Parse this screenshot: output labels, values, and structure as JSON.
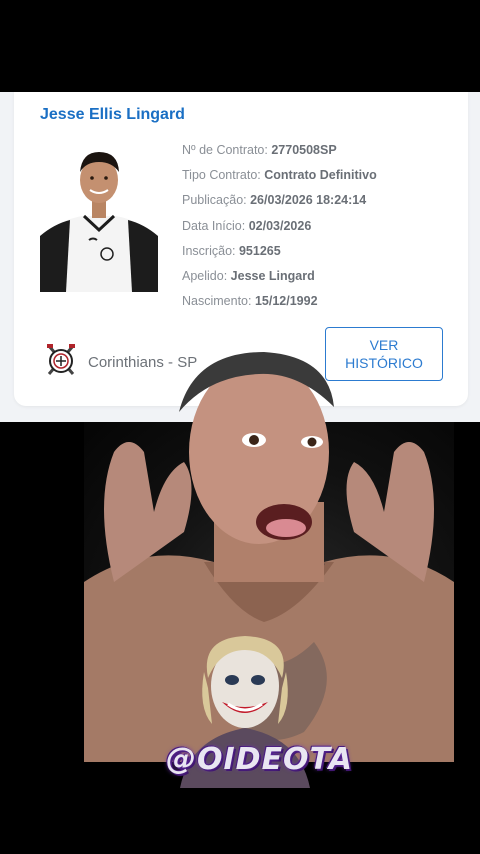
{
  "profile": {
    "name": "Jesse Ellis Lingard",
    "fields": [
      {
        "label": "Nº de Contrato:",
        "value": "2770508SP"
      },
      {
        "label": "Tipo Contrato:",
        "value": "Contrato Definitivo"
      },
      {
        "label": "Publicação:",
        "value": "26/03/2026 18:24:14"
      },
      {
        "label": "Data Início:",
        "value": "02/03/2026"
      },
      {
        "label": "Inscrição:",
        "value": "951265"
      },
      {
        "label": "Apelido:",
        "value": "Jesse Lingard"
      },
      {
        "label": "Nascimento:",
        "value": "15/12/1992"
      }
    ],
    "club": "Corinthians - SP",
    "history_button": {
      "line1": "VER",
      "line2": "HISTÓRICO"
    }
  },
  "overlay": {
    "watermark_text": "@OIDEOTA"
  },
  "colors": {
    "accent": "#1a6fc4",
    "button_border": "#2c7bd0"
  }
}
